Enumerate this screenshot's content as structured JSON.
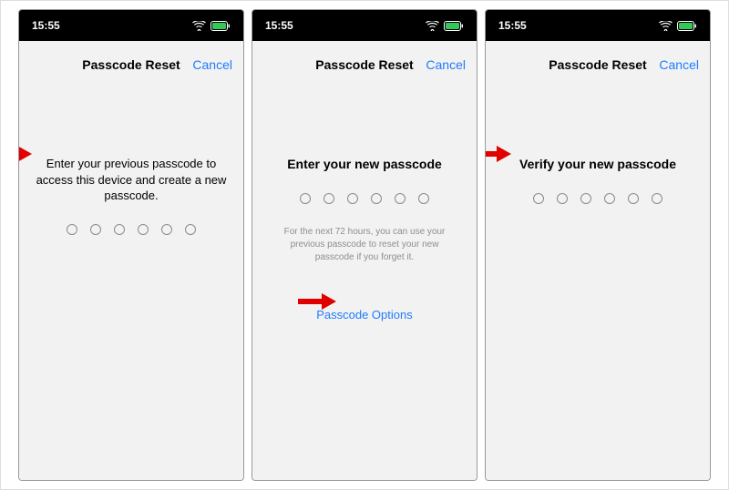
{
  "status": {
    "time": "15:55"
  },
  "screens": {
    "s1": {
      "nav_title": "Passcode Reset",
      "cancel": "Cancel",
      "prompt": "Enter your previous passcode to access this device and create a new passcode."
    },
    "s2": {
      "nav_title": "Passcode Reset",
      "cancel": "Cancel",
      "prompt": "Enter your new passcode",
      "subtext": "For the next 72 hours, you can use your previous passcode to reset your new passcode if you forget it.",
      "options": "Passcode Options"
    },
    "s3": {
      "nav_title": "Passcode Reset",
      "cancel": "Cancel",
      "prompt": "Verify your new passcode"
    }
  }
}
